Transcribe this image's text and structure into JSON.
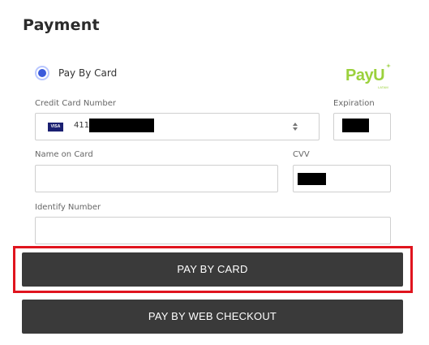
{
  "page": {
    "title": "Payment"
  },
  "payment_method": {
    "option_label": "Pay By Card",
    "selected": true,
    "logo_text": "PayU",
    "logo_subtext": "LATAM"
  },
  "card_number": {
    "label": "Credit Card Number",
    "brand_badge": "VISA",
    "value_prefix": "4111"
  },
  "expiration": {
    "label": "Expiration"
  },
  "name_on_card": {
    "label": "Name on Card",
    "value": ""
  },
  "cvv": {
    "label": "CVV"
  },
  "identify_number": {
    "label": "Identify Number",
    "value": ""
  },
  "buttons": {
    "pay_by_card": "PAY BY CARD",
    "pay_by_web_checkout": "PAY BY WEB CHECKOUT"
  },
  "colors": {
    "button_bg": "#3a3a3a",
    "highlight": "#e0141e",
    "radio_accent": "#3b5bdb",
    "payu_green": "#9bd13c",
    "visa_blue": "#1a1f71"
  },
  "icons": {
    "spinner": "up-down-arrows-icon",
    "card_brand": "visa-icon",
    "logo": "payu-logo"
  }
}
